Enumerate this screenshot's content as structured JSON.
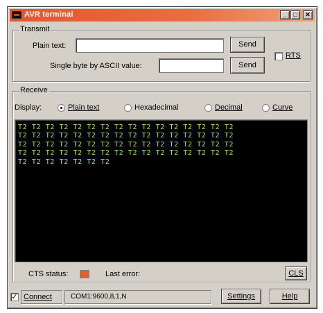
{
  "window": {
    "title": "AVR terminal",
    "min_glyph": "_",
    "max_glyph": "□",
    "close_glyph": "✕"
  },
  "transmit": {
    "group_label": "Transmit",
    "plain_text_label": "Plain text:",
    "plain_text_value": "",
    "send_label": "Send",
    "byte_label": "Single byte by ASCII value:",
    "byte_value": "",
    "send2_label": "Send",
    "rts_label": "RTS",
    "rts_checked": false
  },
  "receive": {
    "group_label": "Receive",
    "display_label": "Display:",
    "options": [
      "Plain text",
      "Hexadecimal",
      "Decimal",
      "Curve"
    ],
    "selected": "Plain text",
    "lines": [
      "T2 T2 T2 T2 T2 T2 T2 T2 T2 T2 T2 T2 T2 T2 T2 T2",
      "T2 T2 T2 T2 T2 T2 T2 T2 T2 T2 T2 T2 T2 T2 T2 T2",
      "T2 T2 T2 T2 T2 T2 T2 T2 T2 T2 T2 T2 T2 T2 T2 T2",
      "T2 T2 T2 T2 T2 T2 T2 T2 T2 T2 T2 T2 T2 T2 T2 T2",
      "T2 T2 T2 T2 T2 T2 T2"
    ],
    "cts_label": "CTS status:",
    "cts_color": "#e06030",
    "last_error_label": "Last error:",
    "last_error_value": "",
    "cls_label": "CLS"
  },
  "statusbar": {
    "connect_label": "Connect",
    "connect_checked": true,
    "check_glyph": "✓",
    "port_info": "COM1:9600,8,1,N",
    "settings_label": "Settings",
    "help_label": "Help"
  }
}
